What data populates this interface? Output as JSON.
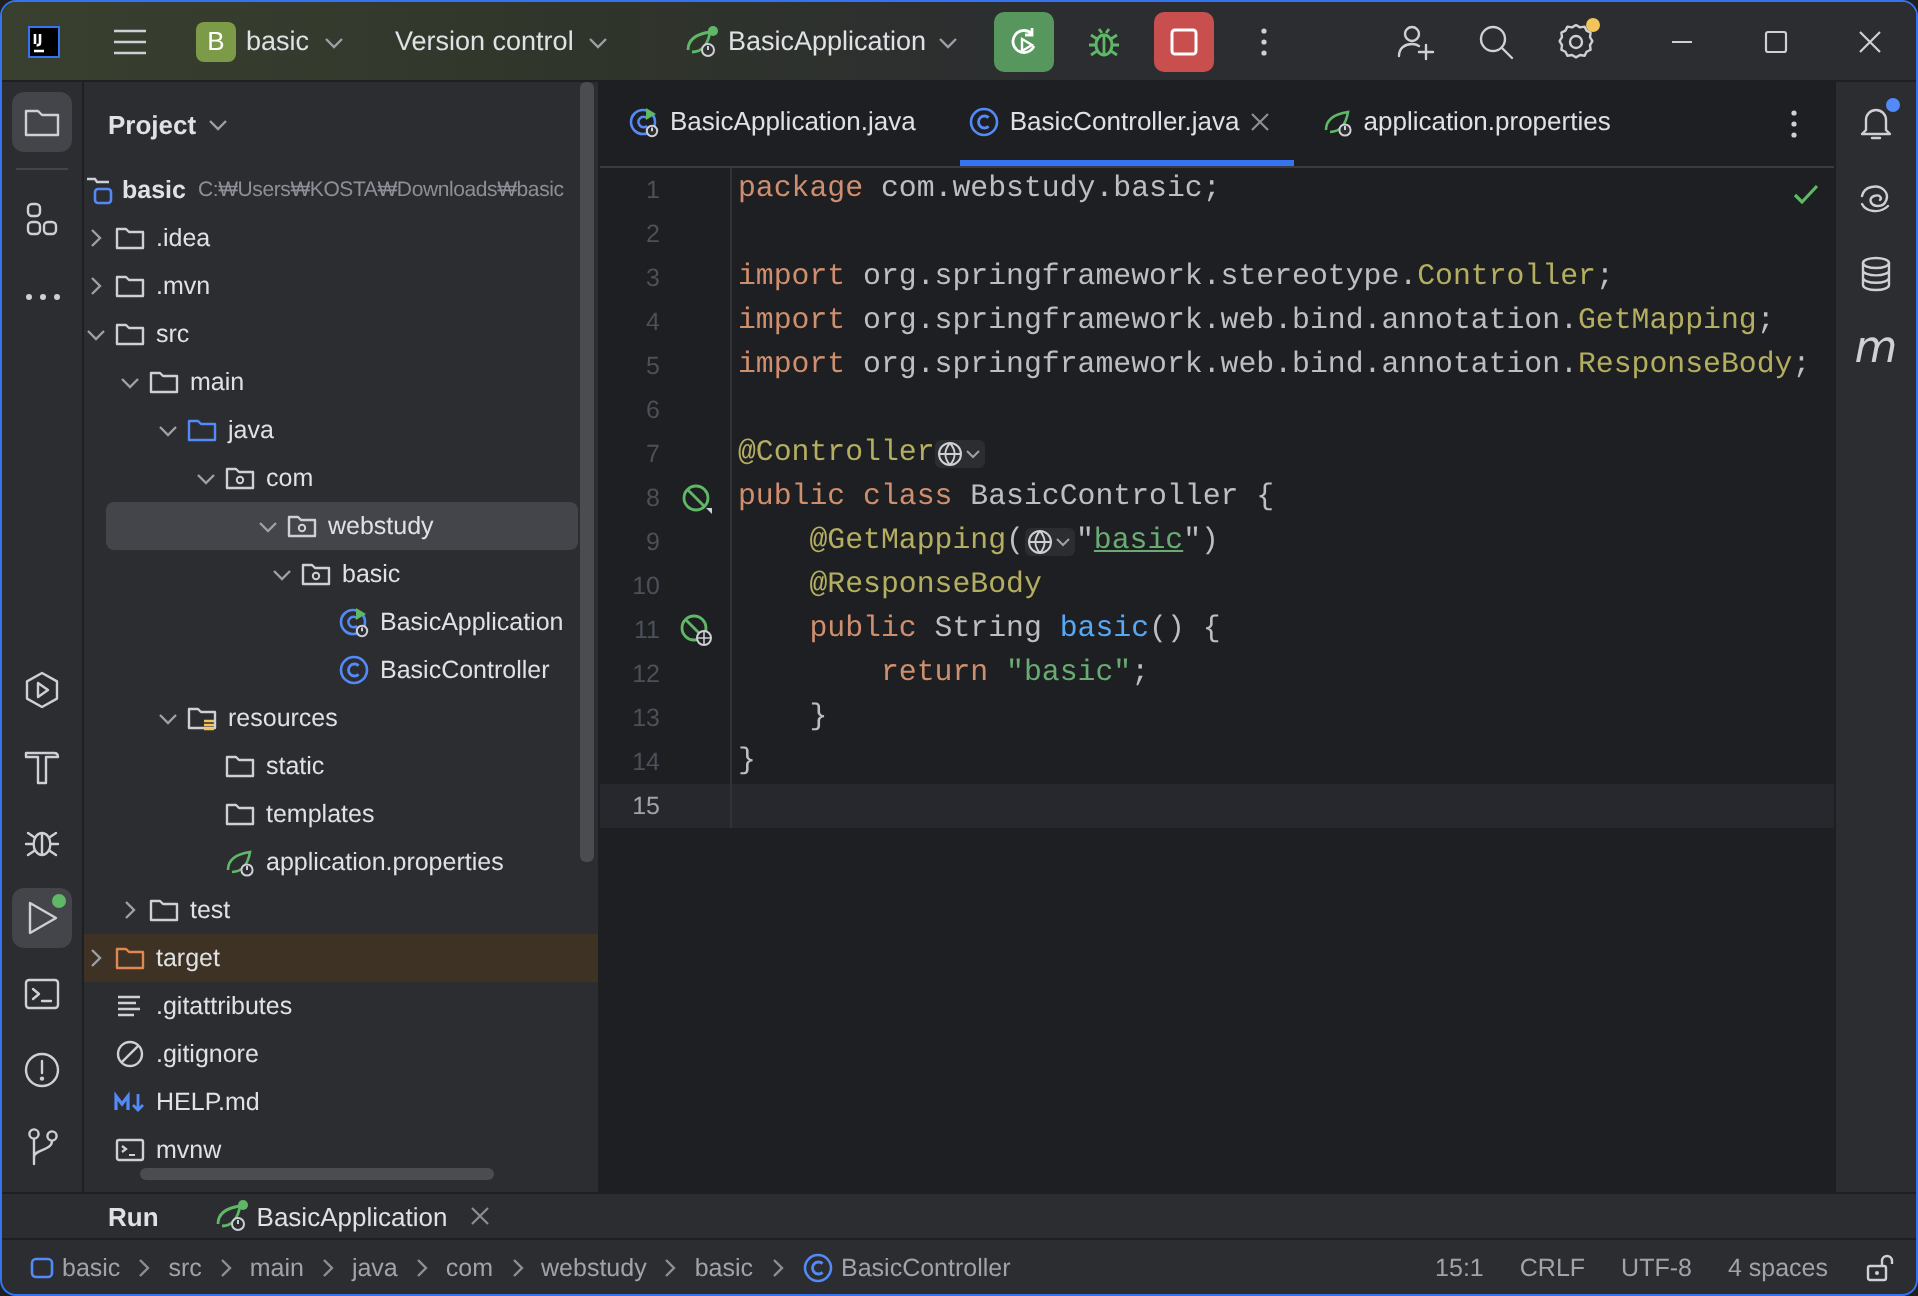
{
  "title_bar": {
    "project": {
      "badge": "B",
      "name": "basic"
    },
    "vcs": "Version control",
    "run_config": "BasicApplication",
    "settings_badge": true
  },
  "tool_windows": {
    "top": [
      {
        "kind": "project",
        "selected": true
      },
      {
        "kind": "structure",
        "selected": false
      },
      {
        "kind": "more",
        "selected": false
      }
    ],
    "bottom": [
      {
        "kind": "services",
        "selected": false
      },
      {
        "kind": "build",
        "selected": false
      },
      {
        "kind": "debug",
        "selected": false
      },
      {
        "kind": "run",
        "selected": true,
        "badge": true
      },
      {
        "kind": "terminal",
        "selected": false
      },
      {
        "kind": "problems",
        "selected": false
      },
      {
        "kind": "git",
        "selected": false
      }
    ]
  },
  "project_panel": {
    "title": "Project",
    "tree": [
      {
        "label": "basic",
        "path": "C:₩Users₩KOSTA₩Downloads₩basic",
        "kind": "module",
        "selected": false,
        "children": [
          {
            "label": ".idea",
            "kind": "folder",
            "expanded": false,
            "selected": false
          },
          {
            "label": ".mvn",
            "kind": "folder",
            "expanded": false,
            "selected": false
          },
          {
            "label": "src",
            "kind": "folder",
            "expanded": true,
            "selected": false,
            "children": [
              {
                "label": "main",
                "kind": "folder",
                "expanded": true,
                "selected": false,
                "children": [
                  {
                    "label": "java",
                    "kind": "source-folder",
                    "expanded": true,
                    "selected": false,
                    "children": [
                      {
                        "label": "com",
                        "kind": "package",
                        "expanded": true,
                        "selected": false,
                        "children": [
                          {
                            "label": "webstudy",
                            "kind": "package",
                            "expanded": true,
                            "selected": true,
                            "children": [
                              {
                                "label": "basic",
                                "kind": "package",
                                "expanded": true,
                                "selected": false,
                                "children": [
                                  {
                                    "label": "BasicApplication",
                                    "kind": "class-run",
                                    "selected": false
                                  },
                                  {
                                    "label": "BasicController",
                                    "kind": "class",
                                    "selected": false
                                  }
                                ]
                              }
                            ]
                          }
                        ]
                      }
                    ]
                  },
                  {
                    "label": "resources",
                    "kind": "resources-folder",
                    "expanded": true,
                    "selected": false,
                    "children": [
                      {
                        "label": "static",
                        "kind": "folder",
                        "selected": false
                      },
                      {
                        "label": "templates",
                        "kind": "folder",
                        "selected": false
                      },
                      {
                        "label": "application.properties",
                        "kind": "spring",
                        "selected": false
                      }
                    ]
                  }
                ]
              },
              {
                "label": "test",
                "kind": "folder",
                "expanded": false,
                "selected": false
              }
            ]
          },
          {
            "label": "target",
            "kind": "excluded-folder",
            "expanded": false,
            "selected": false
          },
          {
            "label": ".gitattributes",
            "kind": "text-file",
            "selected": false
          },
          {
            "label": ".gitignore",
            "kind": "ignore-file",
            "selected": false
          },
          {
            "label": "HELP.md",
            "kind": "markdown",
            "selected": false
          },
          {
            "label": "mvnw",
            "kind": "script",
            "selected": false
          }
        ]
      }
    ]
  },
  "editor_tabs": [
    {
      "label": "BasicApplication.java",
      "kind": "class-run",
      "selected": false
    },
    {
      "label": "BasicController.java",
      "kind": "class",
      "selected": true
    },
    {
      "label": "application.properties",
      "kind": "spring",
      "selected": false
    }
  ],
  "code_lines": [
    {
      "number": "1",
      "current": false,
      "tokens": [
        {
          "kind": "keyword",
          "text": "package"
        },
        {
          "kind": "plain",
          "text": " com.webstudy.basic;"
        }
      ]
    },
    {
      "number": "2",
      "current": false
    },
    {
      "number": "3",
      "current": false,
      "tokens": [
        {
          "kind": "keyword",
          "text": "import"
        },
        {
          "kind": "plain",
          "text": " org.springframework.stereotype."
        },
        {
          "kind": "annotation",
          "text": "Controller"
        },
        {
          "kind": "plain",
          "text": ";"
        }
      ]
    },
    {
      "number": "4",
      "current": false,
      "tokens": [
        {
          "kind": "keyword",
          "text": "import"
        },
        {
          "kind": "plain",
          "text": " org.springframework.web.bind.annotation."
        },
        {
          "kind": "annotation",
          "text": "GetMapping"
        },
        {
          "kind": "plain",
          "text": ";"
        }
      ]
    },
    {
      "number": "5",
      "current": false,
      "tokens": [
        {
          "kind": "keyword",
          "text": "import"
        },
        {
          "kind": "plain",
          "text": " org.springframework.web.bind.annotation."
        },
        {
          "kind": "annotation",
          "text": "ResponseBody"
        },
        {
          "kind": "plain",
          "text": ";"
        }
      ]
    },
    {
      "number": "6",
      "current": false
    },
    {
      "number": "7",
      "current": false,
      "tokens": [
        {
          "kind": "annotation",
          "text": "@Controller"
        },
        {
          "kind": "inlay"
        }
      ]
    },
    {
      "number": "8",
      "current": false,
      "gutter": {
        "kind": "bean"
      },
      "tokens": [
        {
          "kind": "keyword",
          "text": "public class"
        },
        {
          "kind": "plain",
          "text": " BasicController {"
        }
      ]
    },
    {
      "number": "9",
      "current": false,
      "tokens": [
        {
          "kind": "annotation",
          "text": "    @GetMapping"
        },
        {
          "kind": "plain",
          "text": "("
        },
        {
          "kind": "inlay"
        },
        {
          "kind": "plain",
          "text": "\""
        },
        {
          "kind": "url",
          "text": "basic"
        },
        {
          "kind": "plain",
          "text": "\")"
        }
      ]
    },
    {
      "number": "10",
      "current": false,
      "tokens": [
        {
          "kind": "annotation",
          "text": "    @ResponseBody"
        }
      ]
    },
    {
      "number": "11",
      "current": false,
      "gutter": {
        "kind": "endpoint"
      },
      "tokens": [
        {
          "kind": "keyword",
          "text": "    public"
        },
        {
          "kind": "plain",
          "text": " String "
        },
        {
          "kind": "method",
          "text": "basic"
        },
        {
          "kind": "plain",
          "text": "() {"
        }
      ]
    },
    {
      "number": "12",
      "current": false,
      "tokens": [
        {
          "kind": "keyword",
          "text": "        return"
        },
        {
          "kind": "string",
          "text": " \"basic\""
        },
        {
          "kind": "plain",
          "text": ";"
        }
      ]
    },
    {
      "number": "13",
      "current": false,
      "tokens": [
        {
          "kind": "plain",
          "text": "    }"
        }
      ]
    },
    {
      "number": "14",
      "current": false,
      "tokens": [
        {
          "kind": "plain",
          "text": "}"
        }
      ]
    },
    {
      "number": "15",
      "current": true
    }
  ],
  "right_tools": [
    {
      "kind": "notifications",
      "badge": true
    },
    {
      "kind": "ai"
    },
    {
      "kind": "database"
    },
    {
      "kind": "maven",
      "label": "m"
    }
  ],
  "run_panel": {
    "title": "Run",
    "tabs": [
      {
        "label": "BasicApplication",
        "selected": true
      }
    ]
  },
  "status_bar": {
    "breadcrumbs": [
      {
        "label": "basic",
        "kind": "module"
      },
      {
        "label": "src"
      },
      {
        "label": "main"
      },
      {
        "label": "java"
      },
      {
        "label": "com"
      },
      {
        "label": "webstudy"
      },
      {
        "label": "basic"
      },
      {
        "label": "BasicController",
        "kind": "class"
      }
    ],
    "items": [
      "15:1",
      "CRLF",
      "UTF-8",
      "4 spaces"
    ]
  }
}
